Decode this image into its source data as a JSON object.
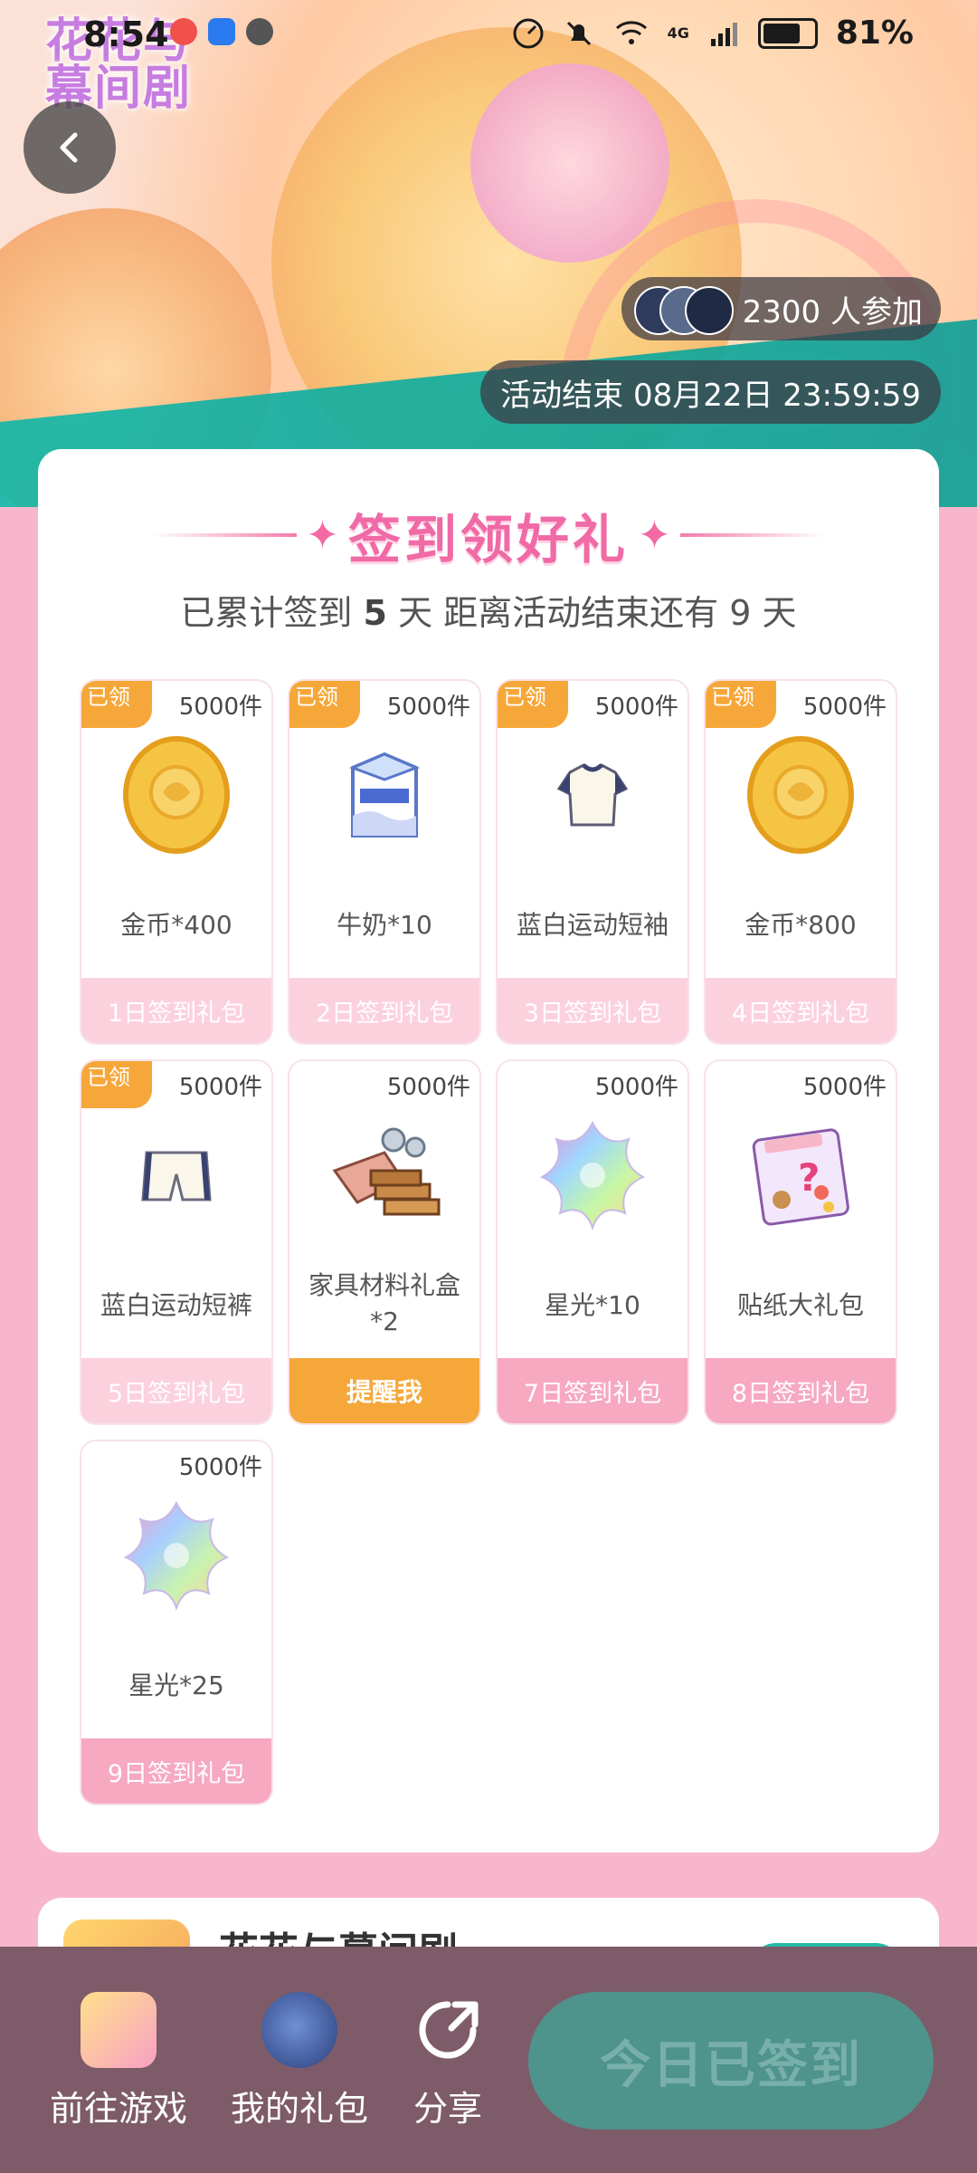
{
  "status": {
    "time": "8:54",
    "battery": "81%",
    "network": "4G"
  },
  "banner": {
    "logo_line1": "花花与",
    "logo_line2": "幕间剧",
    "participants": "2300 人参加",
    "end_time": "活动结束 08月22日 23:59:59"
  },
  "checkin": {
    "title": "签到领好礼",
    "progress_prefix": "已累计签到",
    "signed_days": "5",
    "progress_mid": "天  距离活动结束还有",
    "remaining_days": "9",
    "progress_suffix": "天",
    "claimed_badge": "已领",
    "rewards": [
      {
        "stock": "5000件",
        "name": "金币*400",
        "footer": "1日签到礼包",
        "icon": "gold-coin-icon"
      },
      {
        "stock": "5000件",
        "name": "牛奶*10",
        "footer": "2日签到礼包",
        "icon": "milk-icon"
      },
      {
        "stock": "5000件",
        "name": "蓝白运动短袖",
        "footer": "3日签到礼包",
        "icon": "tshirt-icon"
      },
      {
        "stock": "5000件",
        "name": "金币*800",
        "footer": "4日签到礼包",
        "icon": "gold-coin-icon"
      },
      {
        "stock": "5000件",
        "name": "蓝白运动短裤",
        "footer": "5日签到礼包",
        "icon": "shorts-icon"
      },
      {
        "stock": "5000件",
        "name": "家具材料礼盒",
        "name2": "*2",
        "footer": "提醒我",
        "icon": "furniture-materials-icon"
      },
      {
        "stock": "5000件",
        "name": "星光*10",
        "footer": "7日签到礼包",
        "icon": "starlight-icon"
      },
      {
        "stock": "5000件",
        "name": "贴纸大礼包",
        "footer": "8日签到礼包",
        "icon": "sticker-pack-icon"
      },
      {
        "stock": "5000件",
        "name": "星光*25",
        "footer": "9日签到礼包",
        "icon": "starlight-icon"
      }
    ]
  },
  "next_card": {
    "game_name": "花花与幕间剧"
  },
  "bottom_bar": {
    "go_game": "前往游戏",
    "my_gifts": "我的礼包",
    "share": "分享",
    "signed_button": "今日已签到"
  },
  "colors": {
    "accent_pink": "#f06aa6",
    "claimed_orange": "#f6a73a",
    "footer_pink": "#f6a9c1",
    "bottom_bar": "#7e5b68",
    "teal": "#4e938c"
  }
}
